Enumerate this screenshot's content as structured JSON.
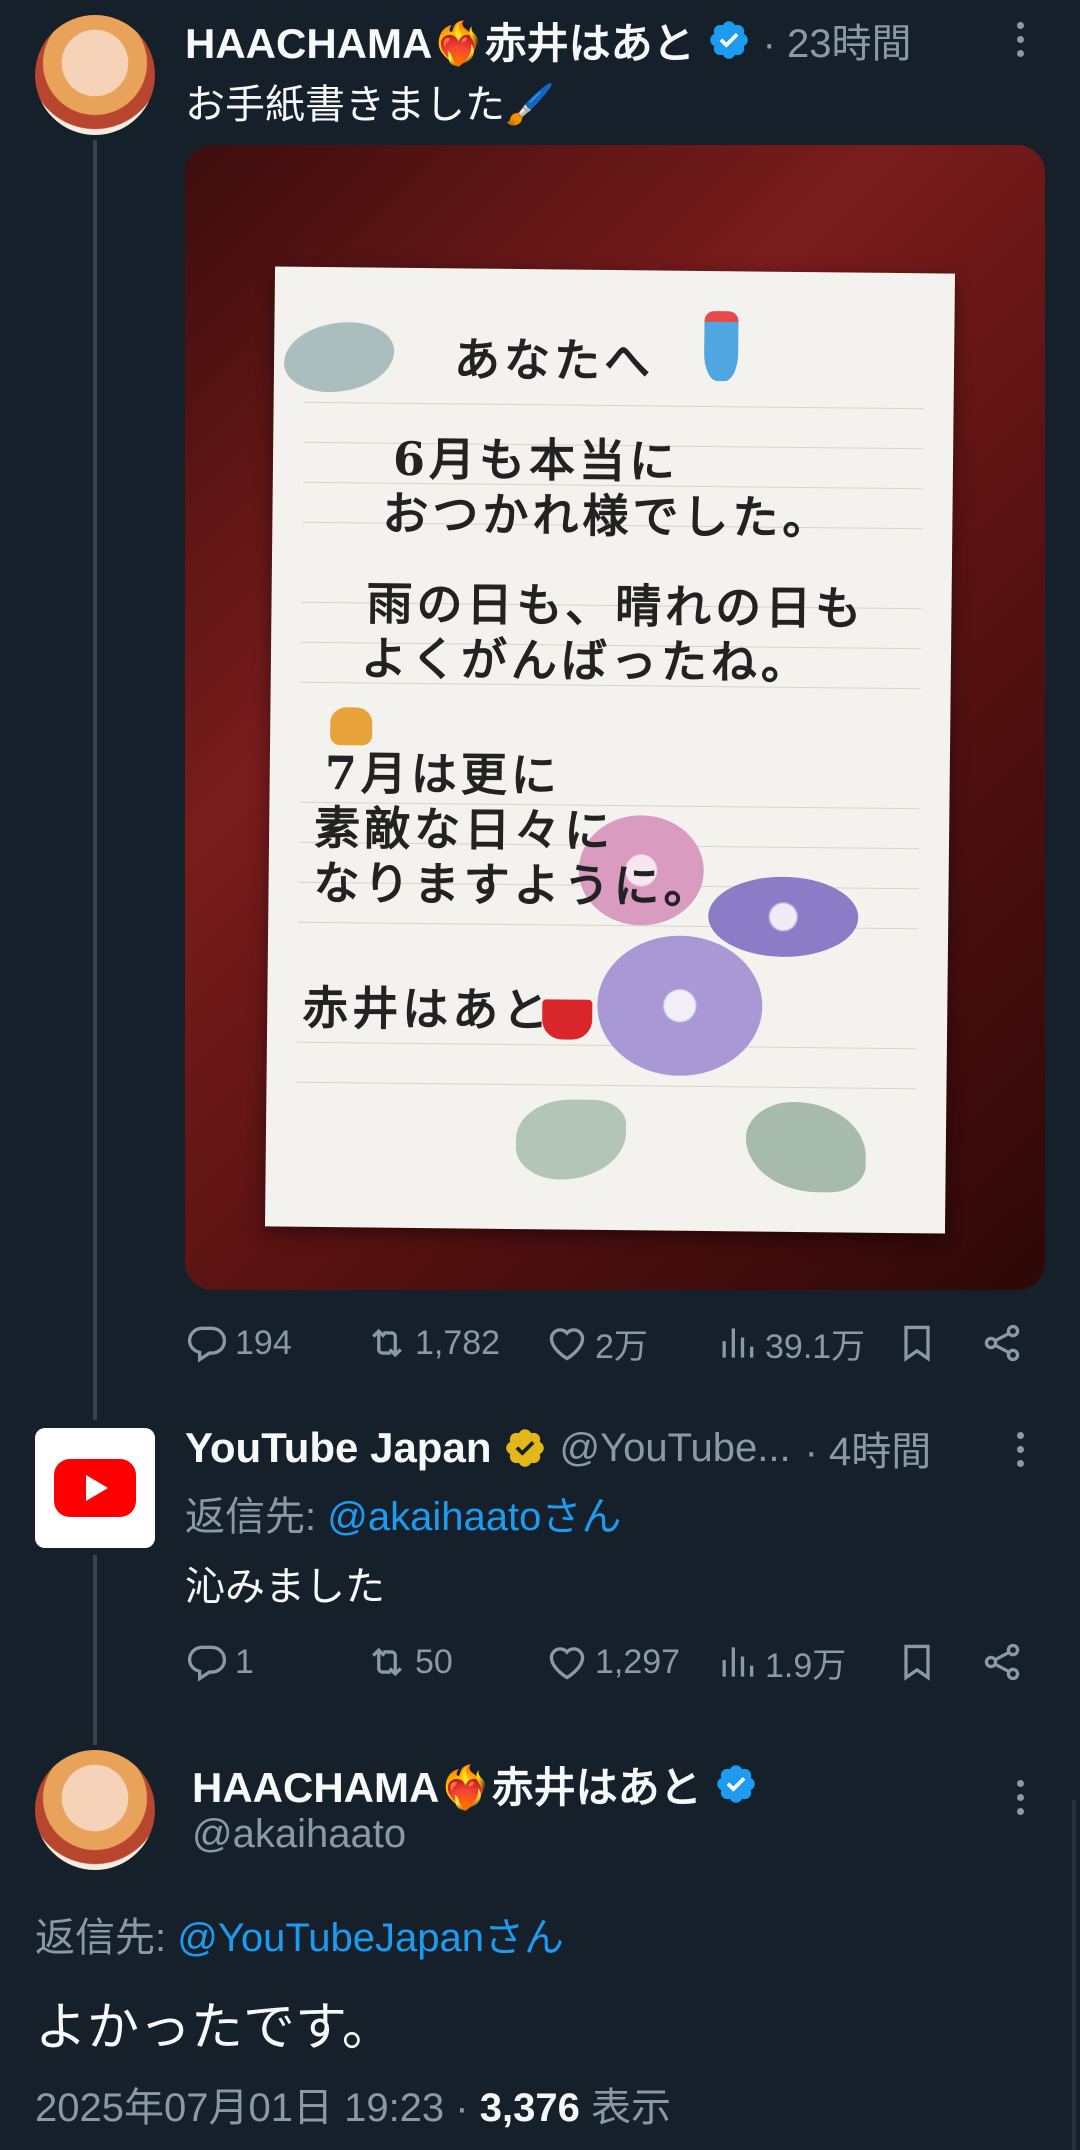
{
  "tweet1": {
    "display_name": "HAACHAMA❤️‍🔥赤井はあと",
    "time": "· 23時間",
    "text": "お手紙書きました🖌️",
    "photo": {
      "letter_lines": [
        "あなたへ",
        "6月も本当に",
        "おつかれ様でした。",
        "雨の日も、晴れの日も",
        "よくがんばったね。",
        "7月は更に",
        "素敵な日々に",
        "なりますように。",
        "赤井はあと"
      ]
    },
    "actions": {
      "replies": "194",
      "retweets": "1,782",
      "likes": "2万",
      "views": "39.1万"
    }
  },
  "tweet2": {
    "display_name": "YouTube Japan",
    "handle": "@YouTube...",
    "time": "· 4時間",
    "reply_prefix": "返信先: ",
    "reply_to": "@akaihaatoさん",
    "text": "沁みました",
    "actions": {
      "replies": "1",
      "retweets": "50",
      "likes": "1,297",
      "views": "1.9万"
    }
  },
  "tweet3": {
    "display_name": "HAACHAMA❤️‍🔥赤井はあと",
    "handle": "@akaihaato",
    "reply_prefix": "返信先: ",
    "reply_to": "@YouTubeJapanさん",
    "text": "よかったです。",
    "timestamp": "2025年07月01日 19:23",
    "separator": " · ",
    "view_count": "3,376",
    "view_label": " 表示"
  },
  "colors": {
    "background": "#15202b",
    "text": "#f7f9f9",
    "muted": "#8b98a5",
    "link": "#1d9bf0",
    "verified_blue": "#1d9bf0",
    "verified_gold": "#e2b719",
    "youtube_red": "#ff0000"
  },
  "icons": [
    "reply-icon",
    "retweet-icon",
    "like-icon",
    "views-icon",
    "bookmark-icon",
    "share-icon",
    "verified-badge-icon",
    "more-icon",
    "youtube-logo-icon"
  ]
}
